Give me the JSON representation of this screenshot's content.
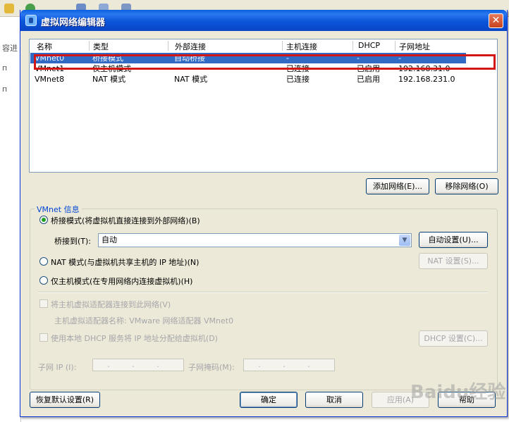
{
  "background": {
    "search_fragment": "容进",
    "side_fragment_1": "п",
    "side_fragment_2": "п"
  },
  "dialog": {
    "title": "虚拟网络编辑器",
    "close_glyph": "✕"
  },
  "network_list": {
    "columns": [
      "名称",
      "类型",
      "外部连接",
      "主机连接",
      "DHCP",
      "子网地址"
    ],
    "rows": [
      {
        "name": "VMnet0",
        "type": "桥接模式",
        "external": "自动桥接",
        "host": "-",
        "dhcp": "-",
        "subnet": "-"
      },
      {
        "name": "VMnet1",
        "type": "仅主机模式",
        "external": "-",
        "host": "已连接",
        "dhcp": "已启用",
        "subnet": "192.168.31.0"
      },
      {
        "name": "VMnet8",
        "type": "NAT 模式",
        "external": "NAT 模式",
        "host": "已连接",
        "dhcp": "已启用",
        "subnet": "192.168.231.0"
      }
    ],
    "selected_row": "VMnet0"
  },
  "list_buttons": {
    "add": "添加网络(E)...",
    "remove": "移除网络(O)"
  },
  "vmnet_info": {
    "legend": "VMnet 信息",
    "bridge_radio": "桥接模式(将虚拟机直接连接到外部网络)(B)",
    "bridge_to_label": "桥接到(T):",
    "bridge_to_value": "自动",
    "auto_settings_button": "自动设置(U)...",
    "nat_radio": "NAT 模式(与虚拟机共享主机的 IP 地址)(N)",
    "nat_settings_button": "NAT 设置(S)...",
    "host_only_radio": "仅主机模式(在专用网络内连接虚拟机)(H)",
    "connect_adapter_check": "将主机虚拟适配器连接到此网络(V)",
    "adapter_name_text": "主机虚拟适配器名称: VMware 网络适配器 VMnet0",
    "dhcp_check": "使用本地 DHCP 服务将 IP 地址分配给虚拟机(D)",
    "dhcp_settings_button": "DHCP 设置(C)...",
    "subnet_ip_label": "子网 IP (I):",
    "subnet_ip_value": ". . .",
    "subnet_mask_label": "子网掩码(M):",
    "subnet_mask_value": ". . ."
  },
  "footer_buttons": {
    "restore_defaults": "恢复默认设置(R)",
    "ok": "确定",
    "cancel": "取消",
    "apply": "应用(A)",
    "help": "帮助"
  },
  "watermark_text": "Baidu经验"
}
